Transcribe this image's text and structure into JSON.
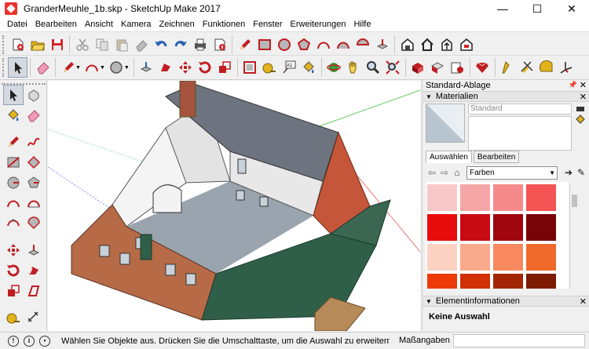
{
  "window": {
    "title": "GranderMeuhle_1b.skp - SketchUp Make 2017",
    "minimize": "—",
    "maximize": "☐",
    "close": "✕"
  },
  "menu": [
    "Datei",
    "Bearbeiten",
    "Ansicht",
    "Kamera",
    "Zeichnen",
    "Funktionen",
    "Fenster",
    "Erweiterungen",
    "Hilfe"
  ],
  "panel": {
    "tray_title": "Standard-Ablage",
    "materials": {
      "header": "Materialien",
      "name_field": "Standard",
      "tabs": [
        "Auswählen",
        "Bearbeiten"
      ],
      "library": "Farben",
      "swatch_colors": [
        "#f8c8c8",
        "#f6a6a6",
        "#f58a8a",
        "#f45454",
        "#e80c0c",
        "#c80a14",
        "#a0060e",
        "#780408",
        "#fbd2c2",
        "#f9aa8c",
        "#f8895e",
        "#f06a2c",
        "#ee3a06",
        "#d03004",
        "#a32604",
        "#7e1c02"
      ]
    },
    "entity_info": {
      "header": "Elementinformationen",
      "value": "Keine Auswahl"
    }
  },
  "status": {
    "message": "Wählen Sie Objekte aus. Drücken Sie die Umschalttaste, um die Auswahl zu erweitern. Zi...",
    "measurements_label": "Maßangaben",
    "measurements_value": ""
  },
  "icons": {
    "accent": "#d3242b",
    "pencil": "#c01e22",
    "blue": "#2a62b0",
    "green": "#3a9a3a",
    "yellow": "#e2b41c"
  }
}
